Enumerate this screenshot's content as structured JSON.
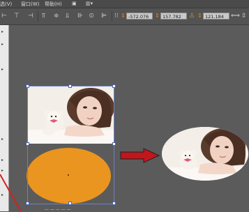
{
  "menu": {
    "items": [
      "选(V)",
      "窗口(W)",
      "帮助(H)"
    ]
  },
  "toolbar": {
    "x_value": "-572.076",
    "y_value": "157.782",
    "w_value": "121.184"
  },
  "canvas": {
    "bottom_caption": "— — — — —"
  },
  "colors": {
    "background": "#5b5b5b",
    "shape_fill": "#ea9520",
    "arrow": "#c0161c",
    "selection": "#6b82c9"
  }
}
